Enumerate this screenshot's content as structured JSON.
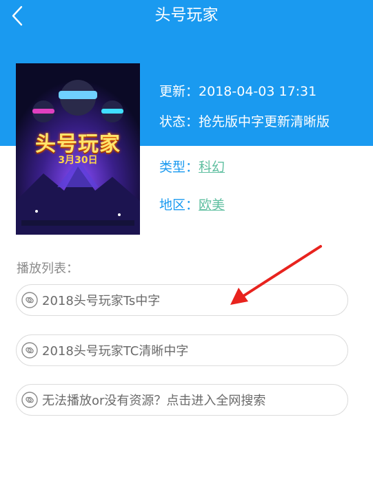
{
  "header": {
    "title": "头号玩家",
    "back_icon": "chevron-left-icon",
    "bg_color": "#1a9af0"
  },
  "movie": {
    "poster": {
      "title": "头号玩家",
      "date": "3月30日"
    },
    "update": {
      "label": "更新：",
      "value": "2018-04-03 17:31"
    },
    "status": {
      "label": "状态：",
      "value": "抢先版中字更新清晰版"
    },
    "genre": {
      "label": "类型：",
      "value": "科幻"
    },
    "region": {
      "label": "地区：",
      "value": "欧美"
    }
  },
  "playlist": {
    "label": "播放列表：",
    "items": [
      {
        "label": "2018头号玩家Ts中字",
        "icon": "link-icon"
      },
      {
        "label": "2018头号玩家TC清晰中字",
        "icon": "link-icon"
      },
      {
        "label": "无法播放or没有资源？点击进入全网搜索",
        "icon": "link-icon"
      }
    ]
  },
  "annotation": {
    "arrow_color": "#e8231e"
  }
}
